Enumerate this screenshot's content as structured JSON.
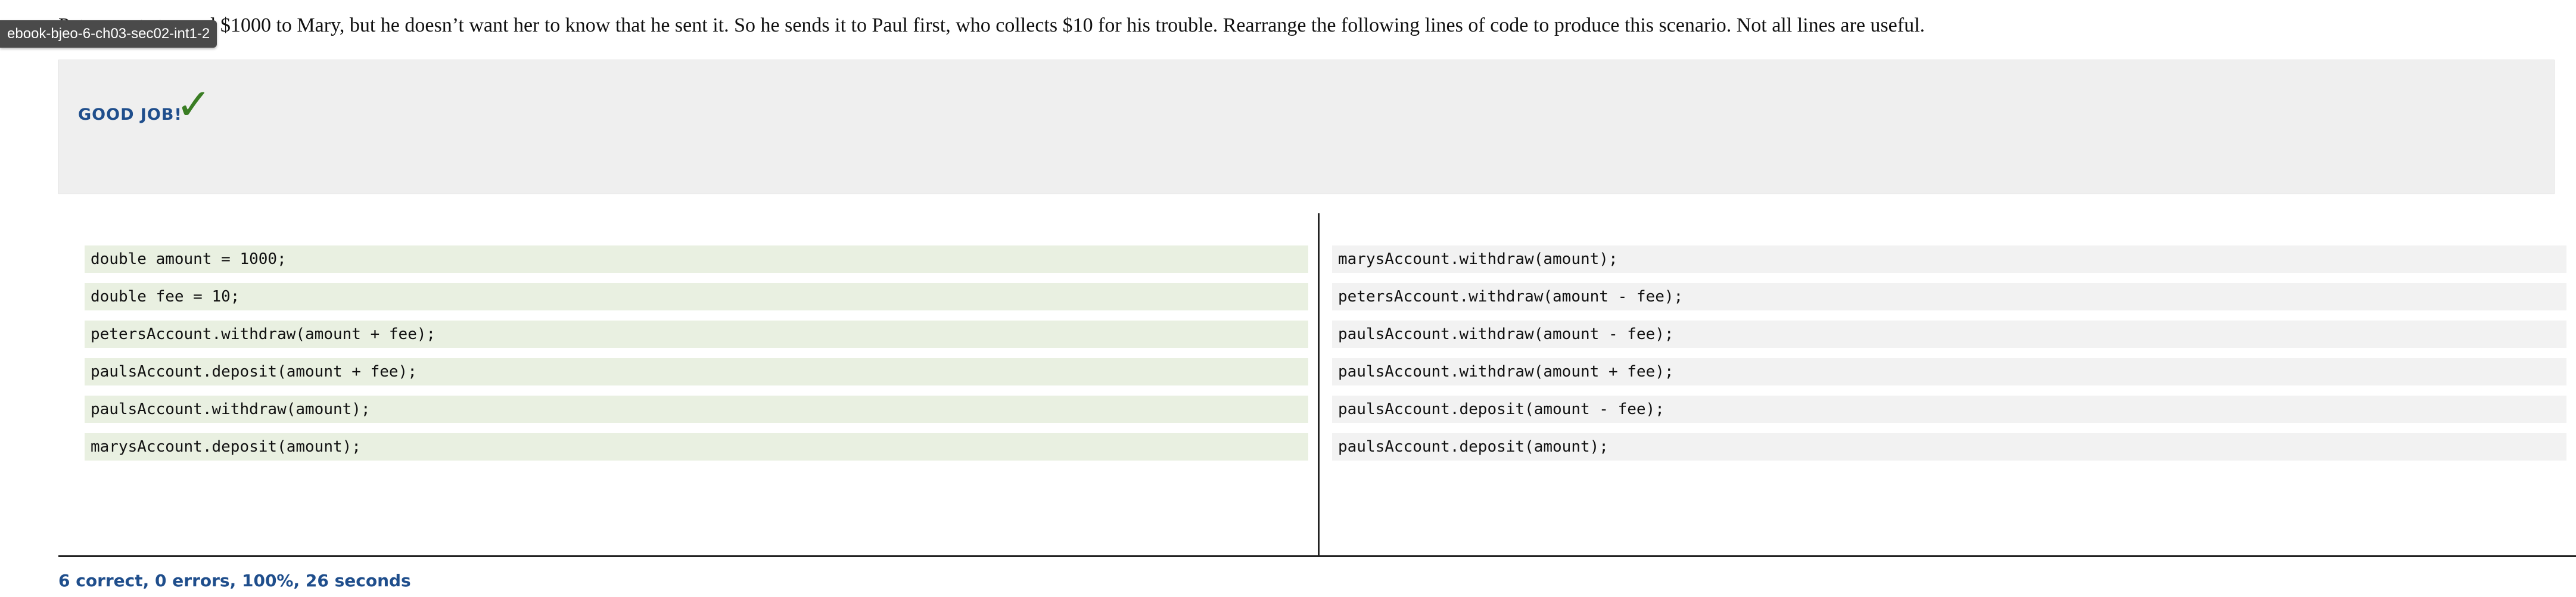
{
  "prompt": "Peter wants to send $1000 to Mary, but he doesn’t want her to know that he sent it. So he sends it to Paul first, who collects $10 for his trouble. Rearrange the following lines of code to produce this scenario. Not all lines are useful.",
  "tag_label": "ebook-bjeo-6-ch03-sec02-int1-2",
  "feedback": {
    "message": "GOOD JOB!",
    "check_icon": "✓"
  },
  "solution_lines": [
    "double amount = 1000;",
    "double fee = 10;",
    "petersAccount.withdraw(amount + fee);",
    "paulsAccount.deposit(amount + fee);",
    "paulsAccount.withdraw(amount);",
    "marysAccount.deposit(amount);"
  ],
  "unused_lines": [
    "marysAccount.withdraw(amount);",
    "petersAccount.withdraw(amount - fee);",
    "paulsAccount.withdraw(amount - fee);",
    "paulsAccount.withdraw(amount + fee);",
    "paulsAccount.deposit(amount - fee);",
    "paulsAccount.deposit(amount);"
  ],
  "status": "6 correct, 0 errors, 100%, 26 seconds",
  "colors": {
    "accent": "#1f4e8c",
    "check": "#3a7d23",
    "solution_bg": "#e9f0e1",
    "unused_bg": "#f2f2f2"
  }
}
